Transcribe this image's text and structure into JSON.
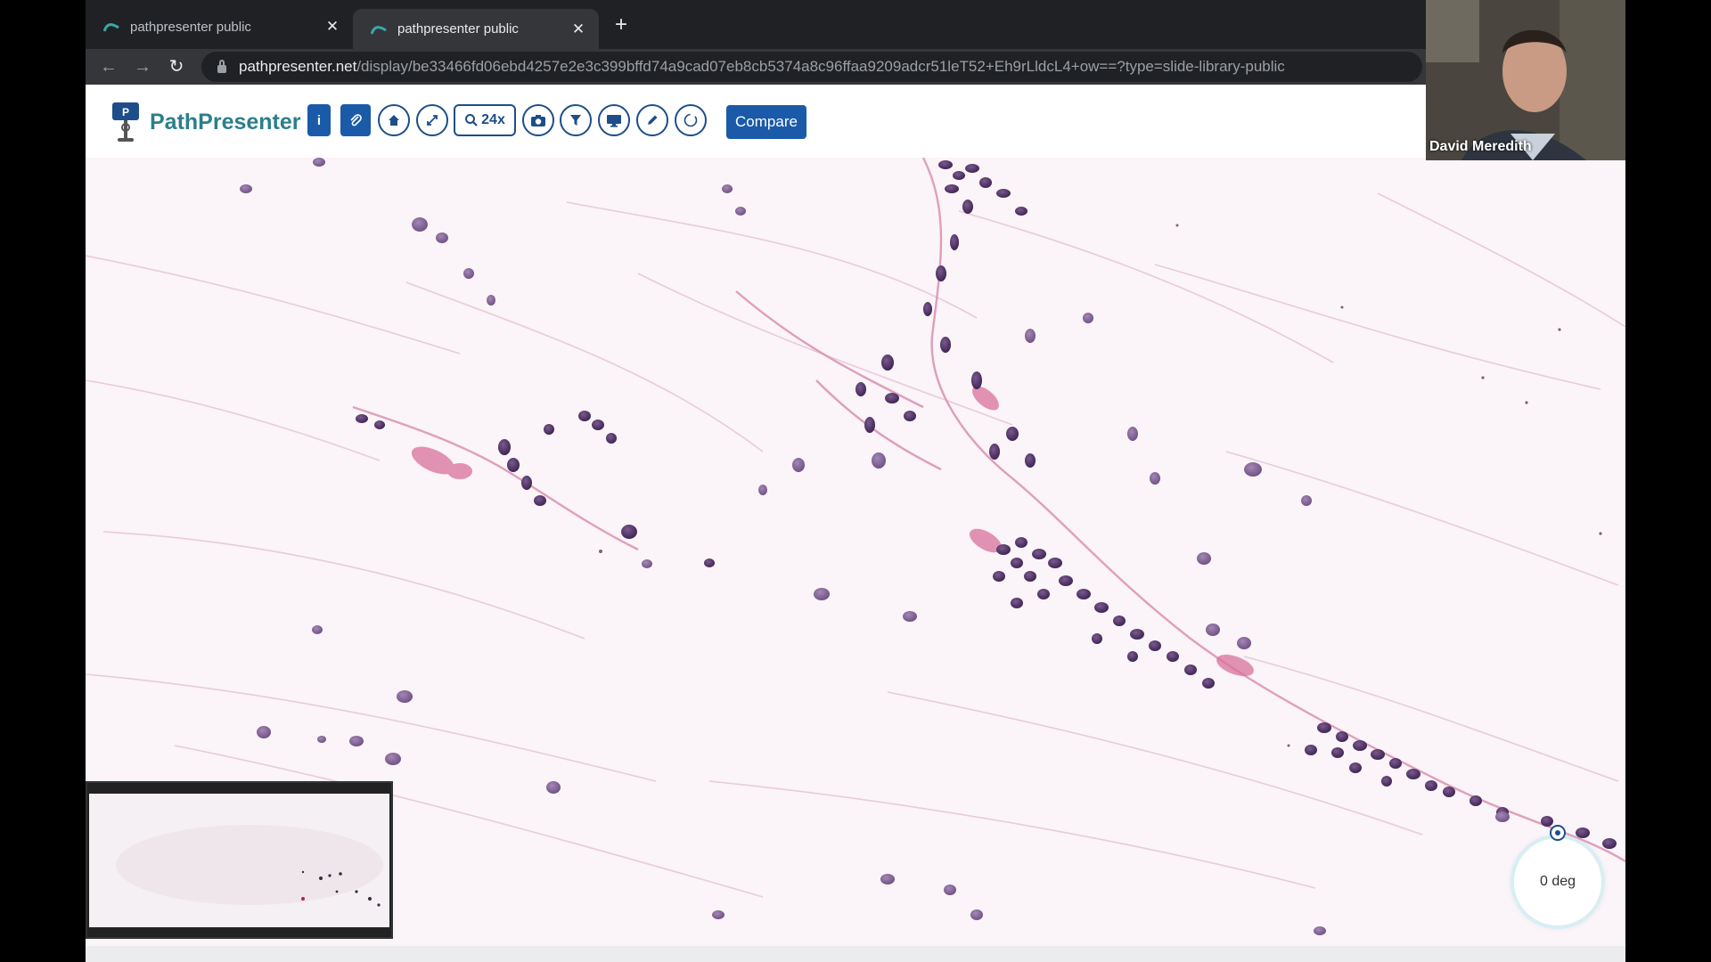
{
  "browser": {
    "tabs": [
      {
        "title": "pathpresenter public",
        "active": false
      },
      {
        "title": "pathpresenter public",
        "active": true
      }
    ],
    "url_host": "pathpresenter.net",
    "url_path": "/display/be33466fd06ebd4257e2e3c399bffd74a9cad07eb8cb5374a8c96ffaa9209adcr51leT52+Eh9rLldcL4+ow==?type=slide-library-public"
  },
  "app": {
    "logo_text": "PathPresenter",
    "toolbar": {
      "info_label": "i",
      "zoom_label": "24x",
      "compare_label": "Compare",
      "icons": [
        "info-icon",
        "paperclip-icon",
        "home-icon",
        "expand-icon",
        "zoom-icon",
        "camera-icon",
        "filter-icon",
        "monitor-icon",
        "pen-icon",
        "rotate-icon"
      ]
    }
  },
  "viewer": {
    "rotation_label": "0 deg"
  },
  "webcam": {
    "name": "David Meredith"
  },
  "colors": {
    "brand_teal": "#2b7f8a",
    "button_blue": "#1a5aa8",
    "tissue_bg": "#fbf4f8",
    "nucleus": "#4a2d5e",
    "eosin": "#d98aa8"
  }
}
